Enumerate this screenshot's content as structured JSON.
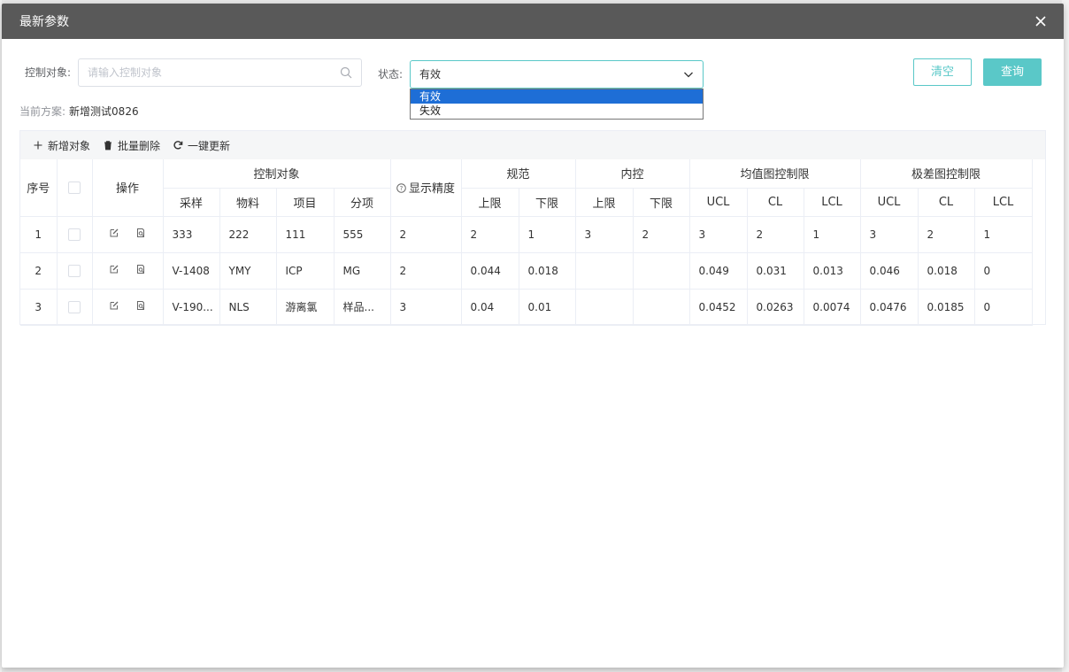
{
  "modal": {
    "title": "最新参数"
  },
  "filters": {
    "object_label": "控制对象:",
    "object_placeholder": "请输入控制对象",
    "status_label": "状态:",
    "status_value": "有效",
    "status_options": [
      "有效",
      "失效"
    ],
    "clear_label": "清空",
    "query_label": "查询"
  },
  "scheme": {
    "label": "当前方案:",
    "value": "新增测试0826"
  },
  "toolbar": {
    "add_label": "新增对象",
    "batch_delete_label": "批量删除",
    "update_label": "一键更新"
  },
  "table": {
    "headers": {
      "seq": "序号",
      "ops": "操作",
      "control_object": "控制对象",
      "precision": "显示精度",
      "spec": "规范",
      "internal": "内控",
      "mean_limits": "均值图控制限",
      "range_limits": "极差图控制限",
      "sample": "采样",
      "material": "物料",
      "item": "项目",
      "subitem": "分项",
      "upper": "上限",
      "lower": "下限",
      "ucl": "UCL",
      "cl": "CL",
      "lcl": "LCL"
    },
    "rows": [
      {
        "seq": "1",
        "sample": "333",
        "material": "222",
        "item": "111",
        "subitem": "555",
        "precision": "2",
        "spec_upper": "2",
        "spec_lower": "1",
        "int_upper": "3",
        "int_lower": "2",
        "m_ucl": "3",
        "m_cl": "2",
        "m_lcl": "1",
        "r_ucl": "3",
        "r_cl": "2",
        "r_lcl": "1"
      },
      {
        "seq": "2",
        "sample": "V-1408",
        "material": "YMY",
        "item": "ICP",
        "subitem": "MG",
        "precision": "2",
        "spec_upper": "0.044",
        "spec_lower": "0.018",
        "int_upper": "",
        "int_lower": "",
        "m_ucl": "0.049",
        "m_cl": "0.031",
        "m_lcl": "0.013",
        "r_ucl": "0.046",
        "r_cl": "0.018",
        "r_lcl": "0"
      },
      {
        "seq": "3",
        "sample": "V-190...",
        "material": "NLS",
        "item": "游离氯",
        "subitem": "样品...",
        "precision": "3",
        "spec_upper": "0.04",
        "spec_lower": "0.01",
        "int_upper": "",
        "int_lower": "",
        "m_ucl": "0.0452",
        "m_cl": "0.0263",
        "m_lcl": "0.0074",
        "r_ucl": "0.0476",
        "r_cl": "0.0185",
        "r_lcl": "0"
      }
    ]
  },
  "colors": {
    "header_bg": "#595959",
    "accent": "#5ac8c8",
    "dropdown_selected": "#1e6ed6"
  }
}
